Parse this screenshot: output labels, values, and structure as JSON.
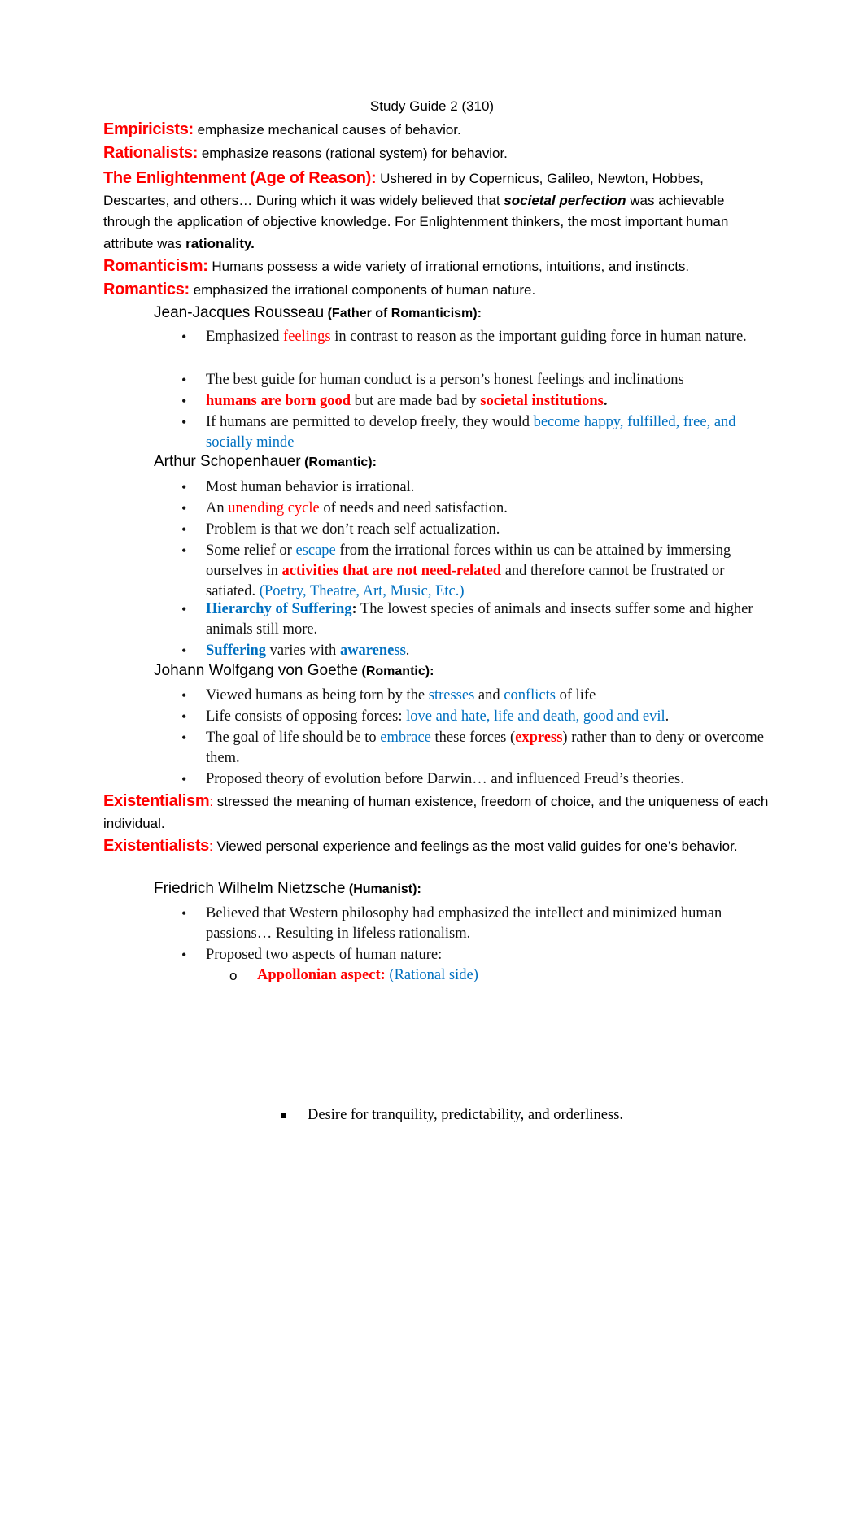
{
  "document": {
    "title": "Study Guide 2 (310)",
    "colors": {
      "term": "#ff0000",
      "emphasis_blue": "#0070c0",
      "text": "#000000"
    }
  },
  "definitions": {
    "empiricists": {
      "term": "Empiricists:",
      "text": " emphasize mechanical causes of behavior."
    },
    "rationalists": {
      "term": "Rationalists:",
      "text": " emphasize reasons (rational system) for behavior."
    },
    "enlightenment": {
      "term": "The Enlightenment (Age of Reason):",
      "text_1": " Ushered in by Copernicus, Galileo, Newton, Hobbes, Descartes, and others… During which it was widely believed that ",
      "emph": "societal perfection",
      "text_2": " was achievable through the application of objective knowledge. For Enlightenment thinkers, the most important human attribute was ",
      "bold": "rationality."
    },
    "romanticism": {
      "term": "Romanticism:",
      "text": " Humans possess a wide variety of irrational emotions, intuitions, and instincts."
    },
    "romantics": {
      "term": "Romantics:",
      "text": " emphasized the irrational components of human nature."
    },
    "existentialism": {
      "term": "Existentialism",
      "colon": ":",
      "text": " stressed the meaning of human existence, freedom of choice, and the uniqueness of each individual."
    },
    "existentialists": {
      "term": "Existentialists",
      "colon": ":",
      "text": " Viewed personal experience and feelings as the most valid guides for one’s behavior."
    }
  },
  "rousseau": {
    "name": "Jean-Jacques Rousseau",
    "tag": " (Father of Romanticism):",
    "bullets": [
      {
        "a": "Emphasized ",
        "red": "feelings",
        "b": " in contrast to reason as the important guiding force in human nature."
      },
      {
        "a": "The best guide for human conduct is a person’s honest feelings and inclinations"
      },
      {
        "red_bold_1": "humans are born good",
        "a": " but are made bad by ",
        "red_bold_2": "societal institutions",
        "b": "."
      },
      {
        "a": "If humans are permitted to develop freely, they would ",
        "blue": "become happy, fulfilled, free, and socially minde"
      }
    ]
  },
  "schopenhauer": {
    "name": "Arthur Schopenhauer",
    "tag": " (Romantic):",
    "bullets": [
      {
        "a": "Most human behavior is irrational."
      },
      {
        "a": "An ",
        "red": "unending cycle",
        "b": " of needs and need satisfaction."
      },
      {
        "a": "Problem is that we don’t reach self actualization."
      },
      {
        "a": "Some relief or ",
        "blue": "escape",
        "b": " from the irrational forces within us can be attained by immersing ourselves in ",
        "red_bold": "activities that are not need-related",
        "c": " and therefore cannot be frustrated or satiated. ",
        "blue_2": "(Poetry, Theatre, Art, Music, Etc.)"
      },
      {
        "blue_bold": "Hierarchy of Suffering",
        "colon": ":",
        "a": " The lowest species of animals and insects suffer some and higher animals still more."
      },
      {
        "blue_bold_1": "Suffering",
        "a": " varies with ",
        "blue_bold_2": "awareness",
        "b": "."
      }
    ]
  },
  "goethe": {
    "name": "Johann Wolfgang von Goethe",
    "tag": " (Romantic):",
    "bullets": [
      {
        "a": "Viewed humans as being torn by the ",
        "blue_1": "stresses",
        "b": " and ",
        "blue_2": "conflicts",
        "c": " of life"
      },
      {
        "a": "Life consists of opposing forces: ",
        "blue": "love and hate, life and death, good and evil",
        "b": "."
      },
      {
        "a": "The goal of life should be to ",
        "blue": "embrace",
        "b": " these forces (",
        "red_bold": "express",
        "c": ") rather than to deny or overcome them."
      },
      {
        "a": "Proposed theory of evolution before Darwin… and influenced Freud’s theories."
      }
    ]
  },
  "nietzsche": {
    "name": "Friedrich Wilhelm Nietzsche",
    "tag": " (Humanist):",
    "bullets": [
      {
        "a": "Believed that Western philosophy had emphasized the intellect and minimized human passions… Resulting in lifeless rationalism."
      },
      {
        "a": "Proposed two aspects of human nature:"
      }
    ],
    "sub_bullet": {
      "red_bold": "Appollonian aspect:",
      "a": " (",
      "blue": "Rational side)"
    },
    "sub_sub_bullet": {
      "a": "Desire for tranquility, predictability, and orderliness."
    }
  }
}
